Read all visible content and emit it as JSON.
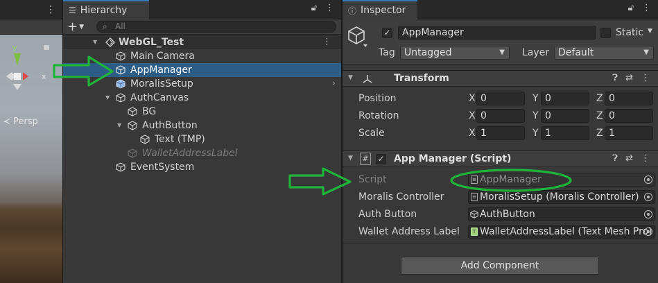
{
  "scene_view": {
    "gizmo": {
      "y_label": "y",
      "x_label": "x"
    },
    "projection_label": "≺ Persp"
  },
  "hierarchy": {
    "tab_label": "Hierarchy",
    "add_label": "+",
    "search_placeholder": "All",
    "scene_name": "WebGL_Test",
    "items": [
      {
        "label": "Main Camera"
      },
      {
        "label": "AppManager",
        "selected": true
      },
      {
        "label": "MoralisSetup"
      },
      {
        "label": "AuthCanvas"
      },
      {
        "label": "BG"
      },
      {
        "label": "AuthButton"
      },
      {
        "label": "Text (TMP)"
      },
      {
        "label": "WalletAddressLabel",
        "inactive": true
      },
      {
        "label": "EventSystem"
      }
    ]
  },
  "inspector": {
    "tab_label": "Inspector",
    "object": {
      "active": true,
      "name": "AppManager",
      "static_label": "Static",
      "tag_label": "Tag",
      "tag_value": "Untagged",
      "layer_label": "Layer",
      "layer_value": "Default"
    },
    "transform": {
      "title": "Transform",
      "rows": [
        {
          "label": "Position",
          "x": "0",
          "y": "0",
          "z": "0"
        },
        {
          "label": "Rotation",
          "x": "0",
          "y": "0",
          "z": "0"
        },
        {
          "label": "Scale",
          "x": "1",
          "y": "1",
          "z": "1"
        }
      ],
      "axis_x": "X",
      "axis_y": "Y",
      "axis_z": "Z"
    },
    "script_component": {
      "title": "App Manager (Script)",
      "enabled": true,
      "fields": [
        {
          "label": "Script",
          "value": "AppManager",
          "disabled": true
        },
        {
          "label": "Moralis Controller",
          "value": "MoralisSetup (Moralis Controller)"
        },
        {
          "label": "Auth Button",
          "value": "AuthButton"
        },
        {
          "label": "Wallet Address Label",
          "value": "WalletAddressLabel (Text Mesh Pro)"
        }
      ]
    },
    "add_component_label": "Add Component"
  },
  "colors": {
    "annotation_green": "#1fb33a",
    "selection_blue": "#2c5d87",
    "tab_accent": "#3a79bb"
  }
}
